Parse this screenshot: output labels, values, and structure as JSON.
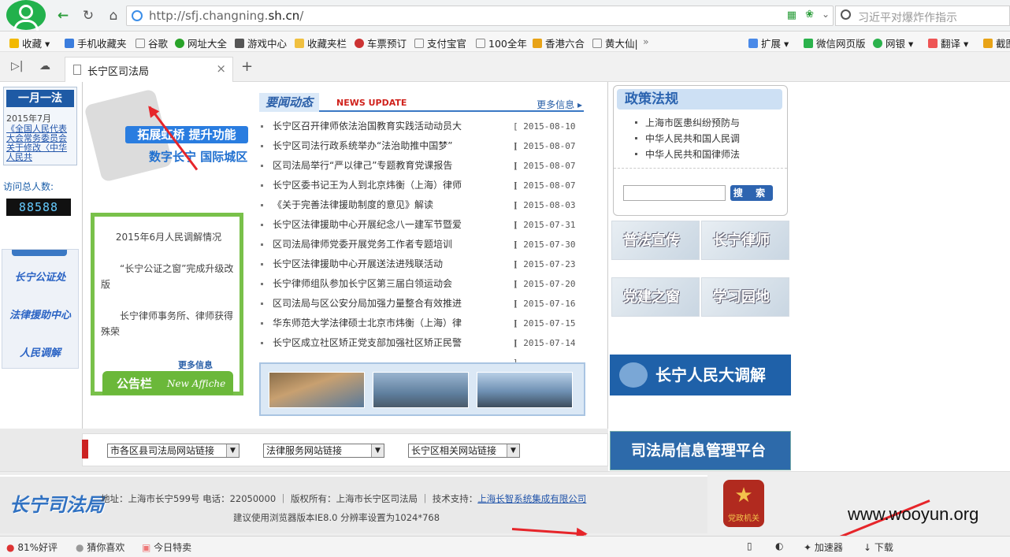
{
  "browser": {
    "url_prefix": "http://sfj.changning.",
    "url_domain": "sh.cn",
    "url_suffix": "/",
    "search_placeholder": "习近平对爆炸作指示",
    "bookmarks": [
      "收藏",
      "手机收藏夹",
      "谷歌",
      "网址大全",
      "游戏中心",
      "收藏夹栏",
      "车票预订",
      "支付宝官",
      "100全年",
      "香港六合",
      "黄大仙|",
      "扩展",
      "微信网页版",
      "网银",
      "翻译",
      "截图"
    ],
    "tab_title": "长宁区司法局",
    "new_tab": "+"
  },
  "left": {
    "monthly_title": "一月一法",
    "monthly_date": "2015年7月",
    "monthly_link": "《全国人民代表大会常务委员会关于修改〈中华人民共",
    "visits_label": "访问总人数:",
    "counter": "88588",
    "links": [
      "长宁公证处",
      "法律援助中心",
      "人民调解"
    ]
  },
  "promo": {
    "line1": "拓展虹桥 提升功能",
    "line2": "数字长宁 国际城区"
  },
  "notice": {
    "items": [
      "2015年6月人民调解情况",
      "“长宁公证之窗”完成升级改版",
      "长宁律师事务所、律师获得殊荣"
    ],
    "more": "更多信息",
    "tab_zh": "公告栏",
    "tab_en": "New Affiche"
  },
  "news": {
    "title_zh": "要闻动态",
    "title_en": "NEWS UPDATE",
    "more": "更多信息 ▸",
    "items": [
      {
        "title": "长宁区召开律师依法治国教育实践活动动员大",
        "date": "[ 2015-08-10 ]"
      },
      {
        "title": "长宁区司法行政系统举办“法治助推中国梦”",
        "date": "[ 2015-08-07 ]"
      },
      {
        "title": "区司法局举行“严以律己”专题教育党课报告",
        "date": "[ 2015-08-07 ]"
      },
      {
        "title": "长宁区委书记王为人到北京炜衡（上海）律师",
        "date": "[ 2015-08-07 ]"
      },
      {
        "title": "《关于完善法律援助制度的意见》解读",
        "date": "[ 2015-08-03 ]"
      },
      {
        "title": "长宁区法律援助中心开展纪念八一建军节暨爱",
        "date": "[ 2015-07-31 ]"
      },
      {
        "title": "区司法局律师党委开展党务工作者专题培训",
        "date": "[ 2015-07-30 ]"
      },
      {
        "title": "长宁区法律援助中心开展送法进残联活动",
        "date": "[ 2015-07-23 ]"
      },
      {
        "title": "长宁律师组队参加长宁区第三届白领运动会",
        "date": "[ 2015-07-20 ]"
      },
      {
        "title": "区司法局与区公安分局加强力量整合有效推进",
        "date": "[ 2015-07-16 ]"
      },
      {
        "title": "华东师范大学法律硕士北京市炜衡（上海）律",
        "date": "[ 2015-07-15 ]"
      },
      {
        "title": "长宁区成立社区矫正党支部加强社区矫正民警",
        "date": "[ 2015-07-14 ]"
      }
    ]
  },
  "policy": {
    "title": "政策法规",
    "items": [
      "上海市医患纠纷预防与",
      "中华人民共和国人民调",
      "中华人民共和国律师法"
    ],
    "search_button": "搜 索"
  },
  "tiles": [
    "普法宣传",
    "长宁律师",
    "党建之窗",
    "学习园地"
  ],
  "banners": {
    "mediation": "长宁人民大调解",
    "management": "司法局信息管理平台"
  },
  "linkbar": {
    "select1": "市各区县司法局网站链接",
    "select2": "法律服务网站链接",
    "select3": "长宁区相关网站链接"
  },
  "footer": {
    "logo": "长宁司法局",
    "line1_text": "地址：上海市长宁599号 电话：22050000 ｜  版权所有：上海市长宁区司法局 ｜ 技术支持：",
    "line1_link": "上海长智系统集成有限公司",
    "line2": "建议使用浏览器版本IE8.0  分辨率设置为1024*768",
    "emblem": "党政机关"
  },
  "watermark": "www.wooyun.org",
  "statusbar": {
    "rating": "81%好评",
    "guess": "猜你喜欢",
    "deals": "今日特卖",
    "accelerator": "加速器",
    "download": "下载"
  },
  "colors": {
    "accent": "#1e5aa5",
    "green": "#79c14a",
    "arrow": "#e6252a"
  }
}
